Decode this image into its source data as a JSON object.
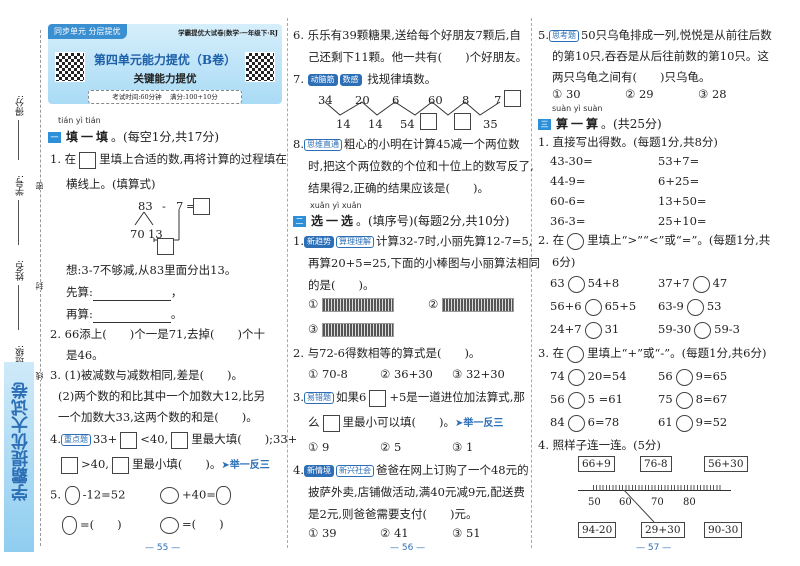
{
  "side": {
    "labels": [
      "得分:",
      "学号:",
      "姓名:",
      "班级:"
    ],
    "seal": [
      "密",
      "封",
      "线"
    ],
    "banner": "学霸提优大试卷"
  },
  "header": {
    "tag": "同步单元 分层提优",
    "series": "学霸提优大试卷|数学·一年级下·RJ",
    "title": "第四单元能力提优（B卷）",
    "subtitle": "关键能力提优",
    "time": "考试时间:60分钟",
    "score": "满分:100+10分"
  },
  "left": {
    "s1": {
      "pinyin": "tián yì tián",
      "num": "一",
      "title": "填一填",
      "note": "。(每空1分,共17分)"
    },
    "q1": {
      "a": "1. 在",
      "b": "里填上合适的数,再将计算的过程填在",
      "c": "横线上。(填算式)",
      "d83": "83",
      "minus": "-",
      "d7": "7",
      "eq": "=",
      "d70": "70",
      "d13": "13",
      "hint": "想:3-7不够减,从83里面分出13。",
      "first": "先算:",
      "then": "再算:",
      "p1": "，",
      "p2": "。"
    },
    "q2": {
      "a": "2. 66添上(　　)个一是71,去掉(　　)个十",
      "b": "是46。"
    },
    "q3": {
      "a": "3. (1)被减数与减数相同,差是(　　)。",
      "b": "(2)两个数的和比其中一个加数大12,比另",
      "c": "一个加数大33,这两个数的和是(　　)。"
    },
    "q4": {
      "n": "4.",
      "tag": "重点题",
      "a": "33+",
      "b": "<40,",
      "c": "里最大填(　　);33+",
      "d": ">40,",
      "e": "里最小填(　　)。",
      "link": "➤举一反三"
    },
    "q5": {
      "n": "5.",
      "a": "-12=52",
      "b": "+40=",
      "c": "=(　　)",
      "d": "=(　　)"
    },
    "page": "— 55 —"
  },
  "mid": {
    "q6": {
      "a": "6. 乐乐有39颗糖果,送给每个好朋友7颗后,自",
      "b": "己还剩下11颗。他一共有(　　)个好朋友。"
    },
    "q7": {
      "n": "7.",
      "tag1": "动脑筋",
      "tag2": "数感",
      "a": "找规律填数。",
      "top": [
        "34",
        "20",
        "6",
        "60",
        "8",
        "7"
      ],
      "bottom": [
        "14",
        "14",
        "54",
        "35"
      ]
    },
    "q8": {
      "n": "8.",
      "tag": "思维直通",
      "a": "粗心的小明在计算45减一个两位数",
      "b": "时,把这个两位数的个位和十位上的数写反了,",
      "c": "结果得2,正确的结果应该是(　　)。"
    },
    "s2": {
      "pinyin": "xuǎn yì xuǎn",
      "num": "二",
      "title": "选一选",
      "note": "。(填序号)(每题2分,共10分)"
    },
    "c1": {
      "n": "1.",
      "tag1": "新趋势",
      "tag2": "算理理解",
      "a": "计算32-7时,小丽先算12-7=5,",
      "b": "再算20+5=25,下面的小棒图与小丽算法相同",
      "c": "的是(　　)。",
      "opts": [
        "①",
        "②",
        "③"
      ]
    },
    "c2": {
      "a": "2. 与72-6得数相等的算式是(　　)。",
      "opts": [
        "① 70-8",
        "② 36+30",
        "③ 32+30"
      ]
    },
    "c3": {
      "n": "3.",
      "tag": "易错题",
      "a": "如果6",
      "b": "+5是一道进位加法算式,那",
      "c": "么",
      "d": "里最小可以填(　　)。",
      "link": "➤举一反三",
      "opts": [
        "① 9",
        "② 5",
        "③ 1"
      ]
    },
    "c4": {
      "n": "4.",
      "tag1": "新情境",
      "tag2": "新兴社会",
      "a": "爸爸在网上订购了一个48元的",
      "b": "披萨外卖,店铺做活动,满40元减9元,配送费",
      "c": "是2元,则爸爸需要支付(　　)元。",
      "opts": [
        "① 39",
        "② 41",
        "③ 51"
      ]
    },
    "page": "— 56 —"
  },
  "right": {
    "c5": {
      "n": "5.",
      "tag": "思考题",
      "a": "50只乌龟排成一列,悦悦是从前往后数",
      "b": "的第10只,吞吞是从后往前数的第10只。这",
      "c": "两只乌龟之间有(　　)只乌龟。",
      "opts": [
        "① 30",
        "② 29",
        "③ 28"
      ]
    },
    "s3": {
      "pinyin": "suàn yì suàn",
      "num": "三",
      "title": "算一算",
      "note": "。(共25分)"
    },
    "k1": {
      "a": "1. 直接写出得数。(每题1分,共8分)",
      "items": [
        "43-30=",
        "53+7=",
        "44-9=",
        "6+25=",
        "60-6=",
        "13+50=",
        "36-3=",
        "25+10="
      ]
    },
    "k2": {
      "a": "2. 在",
      "b": "里填上“>”“<”或“=”。(每题1分,共",
      "c": "6分)",
      "items": [
        [
          "63",
          "54+8"
        ],
        [
          "37+7",
          "47"
        ],
        [
          "56+6",
          "65+5"
        ],
        [
          "63-9",
          "53"
        ],
        [
          "24+7",
          "31"
        ],
        [
          "59-30",
          "59-3"
        ]
      ]
    },
    "k3": {
      "a": "3. 在",
      "b": "里填上“+”或“-”。(每题1分,共6分)",
      "items": [
        [
          "74",
          "20=54"
        ],
        [
          "56",
          "9=65"
        ],
        [
          "56",
          "5 =61"
        ],
        [
          "75",
          "8=67"
        ],
        [
          "84",
          "6=78"
        ],
        [
          "61",
          "9=52"
        ]
      ]
    },
    "k4": {
      "a": "4. 照样子连一连。(5分)",
      "top": [
        "66+9",
        "76-8",
        "56+30"
      ],
      "ticks": [
        "50",
        "60",
        "70",
        "80"
      ],
      "bottom": [
        "94-20",
        "29+30",
        "90-30"
      ]
    },
    "page": "— 57 —"
  },
  "colors": {
    "accent": "#2d6fb6",
    "banner": "#8fcdf0"
  }
}
